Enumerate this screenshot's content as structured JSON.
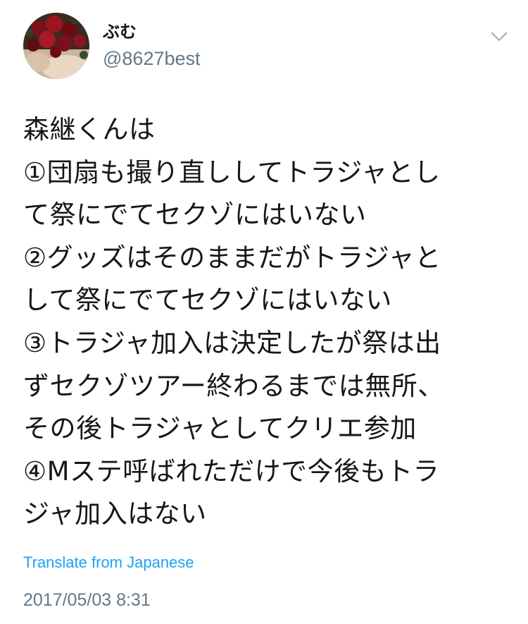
{
  "tweet": {
    "author": {
      "display_name": "ぶむ",
      "username": "@8627best",
      "avatar_icon": "avatar-photo-roses"
    },
    "menu_icon": "chevron-down-icon",
    "text_lines": [
      "森継くんは",
      "①団扇も撮り直ししてトラジャとし",
      "て祭にでてセクゾにはいない",
      "②グッズはそのままだがトラジャと",
      "して祭にでてセクゾにはいない",
      "③トラジャ加入は決定したが祭は出",
      "ずセクゾツアー終わるまでは無所、",
      "その後トラジャとしてクリエ参加",
      "④Mステ呼ばれただけで今後もトラ",
      "ジャ加入はない"
    ],
    "translate_label": "Translate from Japanese",
    "timestamp": "2017/05/03 8:31"
  },
  "colors": {
    "text": "#14171a",
    "secondary": "#657786",
    "link": "#1da1f2",
    "chevron": "#aab8c2"
  }
}
